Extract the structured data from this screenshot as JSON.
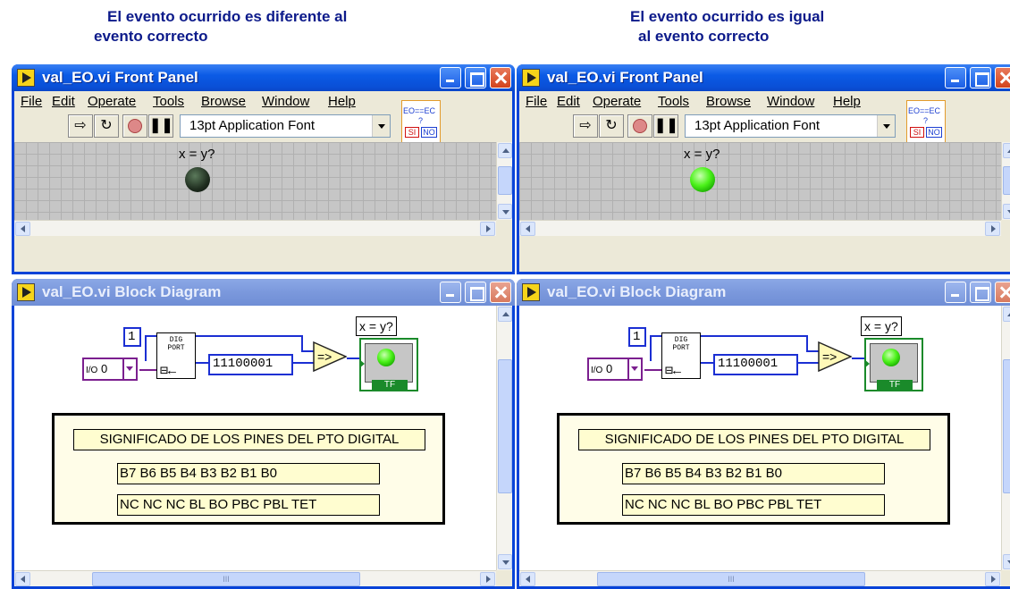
{
  "captions": {
    "left_line1": "El evento ocurrido es diferente al",
    "left_line2": "evento correcto",
    "right_line1": "El evento ocurrido es igual",
    "right_line2": "al evento correcto"
  },
  "front_panel": {
    "title": "val_EO.vi Front Panel",
    "menu": [
      "File",
      "Edit",
      "Operate",
      "Tools",
      "Browse",
      "Window",
      "Help"
    ],
    "font_select": "13pt Application Font",
    "connector": {
      "top": "EO==EC",
      "q": "?",
      "si": "SI",
      "no": "NO"
    },
    "led_label": "x = y?",
    "led_states": {
      "left": "off",
      "right": "on"
    }
  },
  "block_diagram": {
    "title": "val_EO.vi Block Diagram",
    "const_one": "1",
    "const_ring": "0",
    "ring_prefix": "I/O",
    "dig_port_label_1": "DIG",
    "dig_port_label_2": "PORT",
    "const_binary": "11100001",
    "indicator_label": "x = y?",
    "indicator_tf": "TF",
    "sig_title": "SIGNIFICADO DE LOS PINES DEL PTO DIGITAL",
    "sig_bits": "B7   B6   B5  B4  B3    B2    B1    B0",
    "sig_meaning": "NC  NC  NC  BL  BO  PBC  PBL  TET"
  },
  "hscroll_grip": "III",
  "colors": {
    "xp_title_blue": "#0843d8",
    "wire_blue": "#1b2fd3",
    "ring_purple": "#7b1f8f",
    "bool_green": "#1a8a2a",
    "caption_blue": "#0c1a8a"
  }
}
